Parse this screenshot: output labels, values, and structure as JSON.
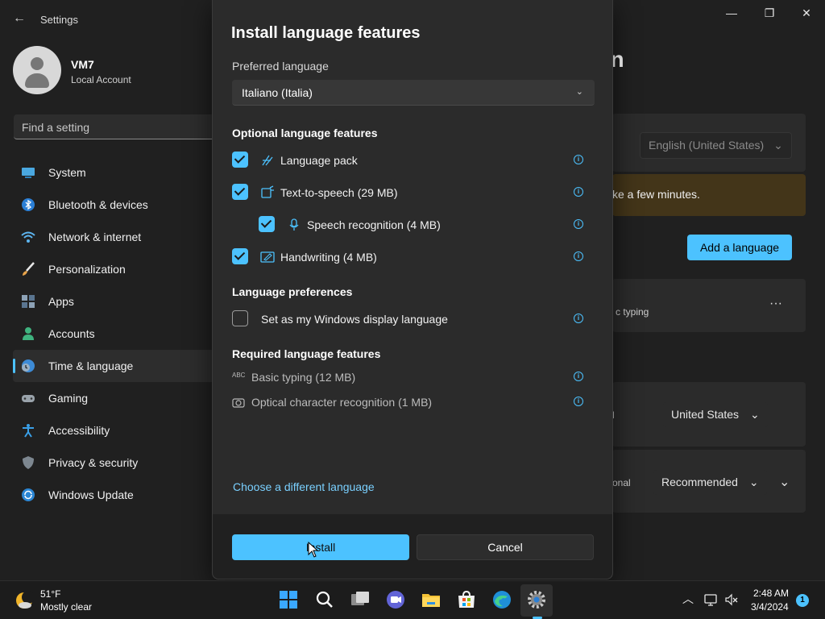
{
  "window": {
    "title": "Settings",
    "back_glyph": "←",
    "minimize_glyph": "—",
    "maximize_glyph": "❐",
    "close_glyph": "✕"
  },
  "profile": {
    "name": "VM7",
    "type": "Local Account"
  },
  "search": {
    "placeholder": "Find a setting"
  },
  "nav": {
    "items": [
      {
        "label": "System",
        "icon": "system-icon"
      },
      {
        "label": "Bluetooth & devices",
        "icon": "bluetooth-icon"
      },
      {
        "label": "Network & internet",
        "icon": "wifi-icon"
      },
      {
        "label": "Personalization",
        "icon": "brush-icon"
      },
      {
        "label": "Apps",
        "icon": "apps-icon"
      },
      {
        "label": "Accounts",
        "icon": "accounts-icon"
      },
      {
        "label": "Time & language",
        "icon": "time-language-icon",
        "active": true
      },
      {
        "label": "Gaming",
        "icon": "gamepad-icon"
      },
      {
        "label": "Accessibility",
        "icon": "accessibility-icon"
      },
      {
        "label": "Privacy & security",
        "icon": "shield-icon"
      },
      {
        "label": "Windows Update",
        "icon": "update-icon"
      }
    ]
  },
  "background": {
    "heading_partial": "egion",
    "display_language_value": "English (United States)",
    "warning_partial": "ke a few minutes.",
    "add_language_label": "Add a language",
    "typing_partial": "c typing",
    "more_glyph": "···",
    "country_label_partial": "l",
    "country_value": "United States",
    "format_label_partial": "onal",
    "format_value": "Recommended",
    "dropdown_glyph": "⌄",
    "expand_glyph": "⌄"
  },
  "dialog": {
    "title": "Install language features",
    "preferred_label": "Preferred language",
    "preferred_value": "Italiano (Italia)",
    "optional_heading": "Optional language features",
    "optional": [
      {
        "label": "Language pack",
        "checked": true
      },
      {
        "label": "Text-to-speech (29 MB)",
        "checked": true
      },
      {
        "label": "Speech recognition (4 MB)",
        "checked": true
      },
      {
        "label": "Handwriting (4 MB)",
        "checked": true
      }
    ],
    "prefs_heading": "Language preferences",
    "display_lang_label": "Set as my Windows display language",
    "required_heading": "Required language features",
    "required": [
      {
        "label": "Basic typing (12 MB)",
        "icon_text": "ABC"
      },
      {
        "label": "Optical character recognition (1 MB)"
      }
    ],
    "info_glyph": "i",
    "dropdown_glyph": "⌄",
    "link": "Choose a different language",
    "install_label": "Install",
    "cancel_label": "Cancel"
  },
  "taskbar": {
    "weather_temp": "51°F",
    "weather_desc": "Mostly clear",
    "time": "2:48 AM",
    "date": "3/4/2024",
    "notification_count": "1",
    "chevron_glyph": "︿"
  },
  "colors": {
    "accent": "#4cc2ff",
    "background": "#202020",
    "dialog": "#2b2b2b"
  }
}
